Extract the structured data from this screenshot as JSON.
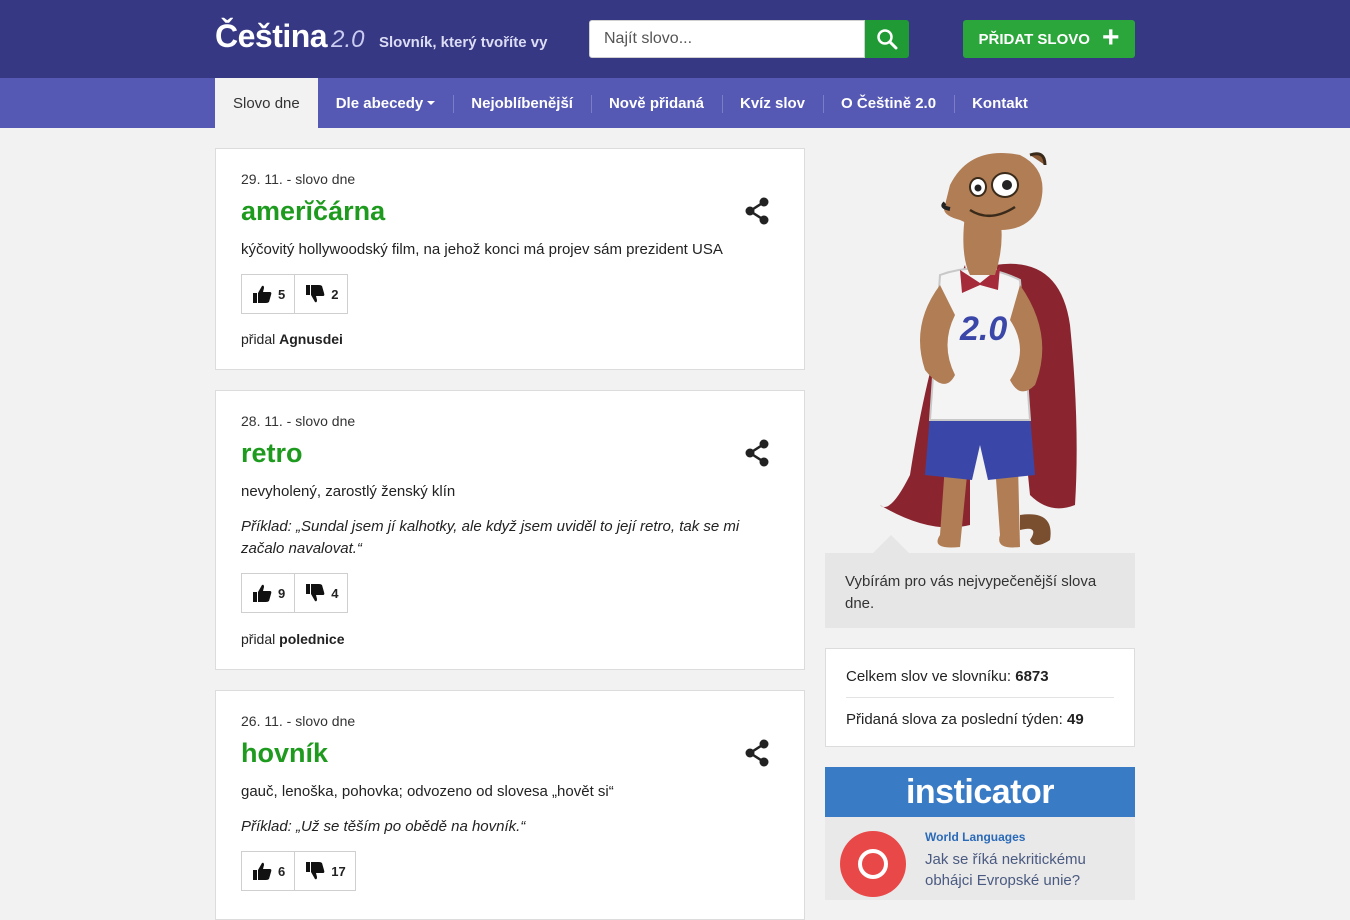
{
  "header": {
    "logo_name": "Čeština",
    "logo_version": "2.0",
    "tagline": "Slovník, který tvoříte vy",
    "search_placeholder": "Najít slovo...",
    "add_word_label": "PŘIDAT SLOVO",
    "add_word_icon": "+"
  },
  "nav": {
    "items": [
      {
        "label": "Slovo dne",
        "active": true
      },
      {
        "label": "Dle abecedy",
        "dropdown": true
      },
      {
        "label": "Nejoblíbenější"
      },
      {
        "label": "Nově přidaná"
      },
      {
        "label": "Kvíz slov"
      },
      {
        "label": "O Češtině 2.0"
      },
      {
        "label": "Kontakt"
      }
    ]
  },
  "words": [
    {
      "date": "29. 11. - slovo dne",
      "word": "amerĭčárna",
      "definition": "kýčovitý hollywoodský film, na jehož konci má projev sám prezident USA",
      "example": "",
      "upvotes": "5",
      "downvotes": "2",
      "added_by_prefix": "přidal",
      "added_by": "Agnusdei"
    },
    {
      "date": "28. 11. - slovo dne",
      "word": "retro",
      "definition": "nevyholený, zarostlý ženský klín",
      "example": "Příklad: „Sundal jsem jí kalhotky, ale když jsem uviděl to její retro, tak se mi začalo navalovat.“",
      "upvotes": "9",
      "downvotes": "4",
      "added_by_prefix": "přidal",
      "added_by": "polednice"
    },
    {
      "date": "26. 11. - slovo dne",
      "word": "hovník",
      "definition": "gauč, lenoška, pohovka; odvozeno od slovesa „hovět si“",
      "example": "Příklad: „Už se těším po obědě na hovník.“",
      "upvotes": "6",
      "downvotes": "17",
      "added_by_prefix": "",
      "added_by": ""
    }
  ],
  "sidebar": {
    "quote": "Vybírám pro vás nejvypečenější slova dne.",
    "stats": {
      "total_label": "Celkem slov ve slovníku:",
      "total_value": "6873",
      "week_label": "Přidaná slova za poslední týden:",
      "week_value": "49"
    },
    "ad": {
      "brand": "insticator",
      "category": "World Languages",
      "headline": "Jak se říká nekritickému obhájci Evropské unie?"
    }
  },
  "icons": {
    "search": "search-icon",
    "share": "share-icon",
    "thumb_up": "thumbs-up-icon",
    "thumb_down": "thumbs-down-icon"
  },
  "colors": {
    "header_bg": "#363884",
    "nav_bg": "#5659b3",
    "accent_green": "#2aa63b",
    "word_green": "#1e9a1e",
    "ad_blue": "#3a7bc6"
  }
}
